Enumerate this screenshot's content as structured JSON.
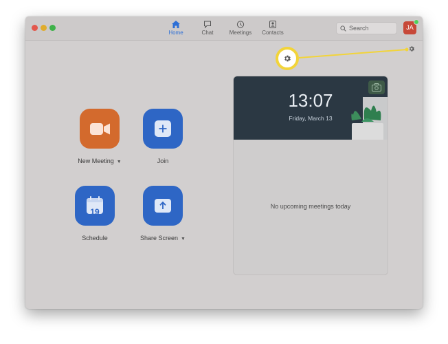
{
  "nav": {
    "tabs": [
      {
        "label": "Home",
        "icon": "home-icon",
        "active": true
      },
      {
        "label": "Chat",
        "icon": "chat-icon",
        "active": false
      },
      {
        "label": "Meetings",
        "icon": "clock-icon",
        "active": false
      },
      {
        "label": "Contacts",
        "icon": "contacts-icon",
        "active": false
      }
    ],
    "search_label": "Search",
    "avatar_initials": "JA"
  },
  "actions": [
    {
      "label": "New Meeting",
      "icon": "video-camera-icon",
      "color": "#d36a2d",
      "has_dropdown": true
    },
    {
      "label": "Join",
      "icon": "plus-icon",
      "color": "#2e66c5",
      "has_dropdown": false
    },
    {
      "label": "Schedule",
      "icon": "calendar-icon",
      "color": "#2e66c5",
      "has_dropdown": false,
      "calendar_day": "19"
    },
    {
      "label": "Share Screen",
      "icon": "share-up-arrow-icon",
      "color": "#2e66c5",
      "has_dropdown": true
    }
  ],
  "meeting_card": {
    "time": "13:07",
    "date": "Friday, March 13",
    "empty_message": "No upcoming meetings today"
  },
  "colors": {
    "accent_blue": "#2d6fd6",
    "callout_yellow": "#f2d43a",
    "window_bg": "#d2cfcf"
  }
}
